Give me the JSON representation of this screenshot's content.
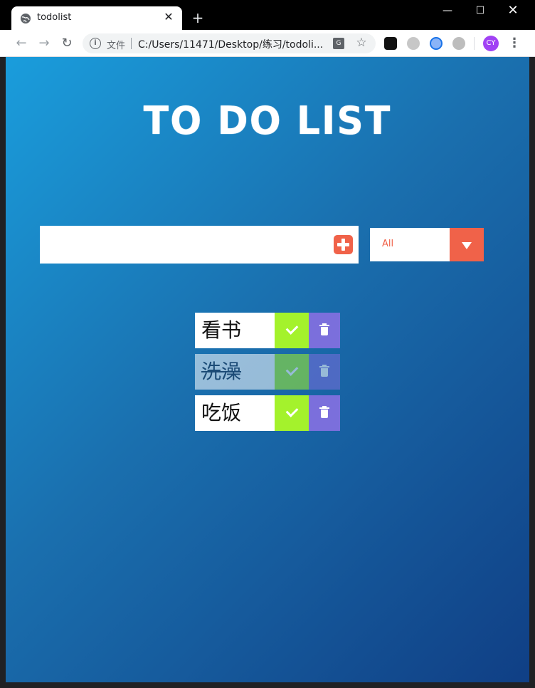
{
  "browser": {
    "tab_title": "todolist",
    "new_tab_symbol": "+",
    "close_tab_symbol": "✕",
    "scheme_label": "文件",
    "url": "C:/Users/11471/Desktop/练习/todoli...",
    "avatar_initials": "CY",
    "window_controls": {
      "minimize": "—",
      "maximize": "☐",
      "close": "✕"
    }
  },
  "app": {
    "title": "TO DO LIST",
    "input": {
      "value": "",
      "placeholder": ""
    },
    "filter": {
      "selected": "All"
    },
    "todos": [
      {
        "text": "看书",
        "completed": false
      },
      {
        "text": "洗澡",
        "completed": true
      },
      {
        "text": "吃饭",
        "completed": false
      }
    ]
  },
  "colors": {
    "accent": "#f06249",
    "check": "#a4f22c",
    "trash": "#7b6fdc",
    "bg_start": "#1a9ddc",
    "bg_end": "#103f85"
  }
}
